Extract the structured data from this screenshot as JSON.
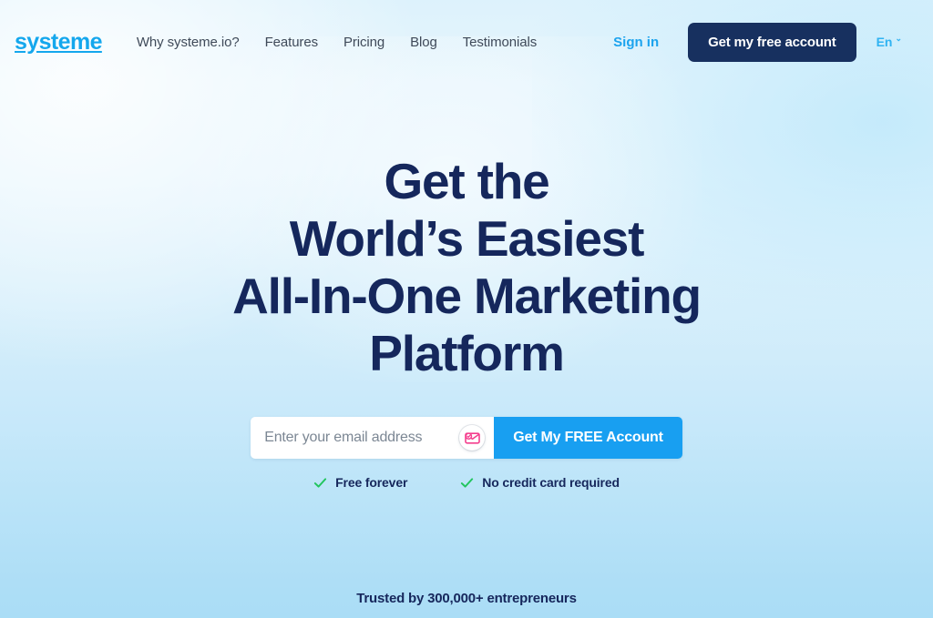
{
  "brand": {
    "logo_text": "systeme",
    "logo_color": "#14a7ed"
  },
  "header": {
    "nav": [
      {
        "label": "Why systeme.io?"
      },
      {
        "label": "Features"
      },
      {
        "label": "Pricing"
      },
      {
        "label": "Blog"
      },
      {
        "label": "Testimonials"
      }
    ],
    "signin_label": "Sign in",
    "cta_label": "Get my free account",
    "cta_bg": "#17305f",
    "language": {
      "label": "En",
      "chevron": "⌄",
      "color": "#2fb3f2"
    }
  },
  "hero": {
    "headline_lines": [
      "Get the",
      "World’s Easiest",
      "All-In-One Marketing",
      "Platform"
    ],
    "headline_color": "#15275c"
  },
  "signup_form": {
    "email_placeholder": "Enter your email address",
    "email_value": "",
    "envelope_icon": "envelope-icon",
    "submit_label": "Get My FREE Account",
    "submit_bg": "#189ff1"
  },
  "benefits": [
    {
      "icon": "check-icon",
      "label": "Free forever",
      "color": "#22c55e"
    },
    {
      "icon": "check-icon",
      "label": "No credit card required",
      "color": "#22c55e"
    }
  ],
  "trust": {
    "label": "Trusted by 300,000+ entrepreneurs"
  }
}
